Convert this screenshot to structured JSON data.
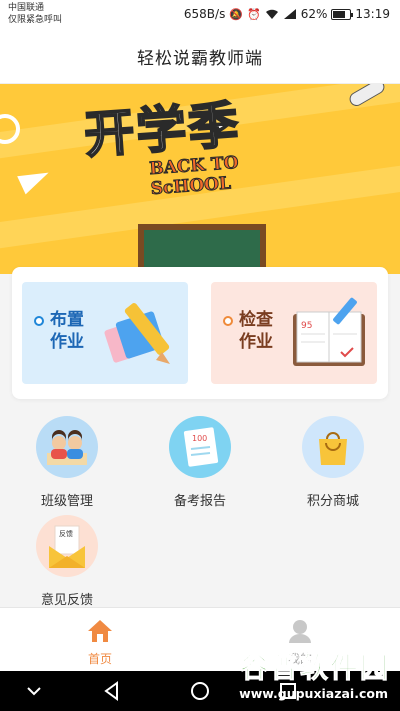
{
  "status_bar": {
    "carrier_line1": "中国联通",
    "carrier_line2": "仅限紧急呼叫",
    "net_speed": "658B/s",
    "battery": "62%",
    "time": "13:19"
  },
  "header": {
    "title": "轻松说霸教师端"
  },
  "banner": {
    "headline": "开学季",
    "subline1": "BACK TO",
    "subline2": "ScHOOL"
  },
  "homework": {
    "assign": {
      "label": "布置作业",
      "accent": "#1f86d8"
    },
    "check": {
      "label": "检查作业",
      "accent": "#ef8a3a",
      "score_text": "95"
    }
  },
  "grid": [
    {
      "label": "班级管理",
      "icon": "class-management-icon"
    },
    {
      "label": "备考报告",
      "icon": "exam-report-icon"
    },
    {
      "label": "积分商城",
      "icon": "shopping-bag-icon"
    },
    {
      "label": "意见反馈",
      "icon": "feedback-envelope-icon"
    }
  ],
  "feedback_card_text": "反馈",
  "report_card_text": "100",
  "bottom_nav": {
    "home": {
      "label": "首页",
      "icon": "home-icon",
      "active_color": "#f08a42"
    },
    "mine": {
      "label": "我的",
      "icon": "user-icon"
    }
  },
  "watermark": {
    "main": "谷普软件园",
    "url": "www.gupuxiazai.com"
  }
}
